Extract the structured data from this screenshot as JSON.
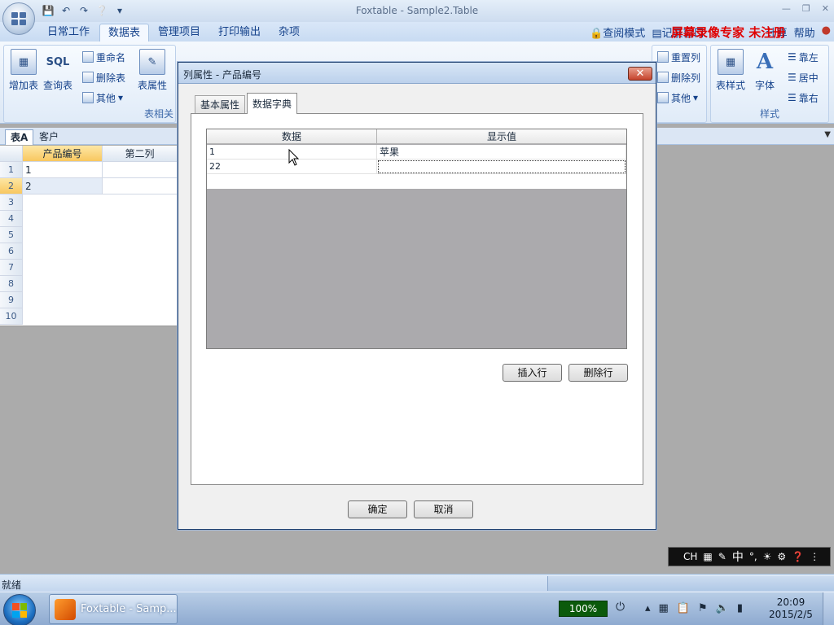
{
  "window": {
    "title": "Foxtable - Sample2.Table"
  },
  "ribbon_tabs": [
    "日常工作",
    "数据表",
    "管理项目",
    "打印输出",
    "杂项"
  ],
  "right_tools": [
    "查阅模式",
    "记录窗口",
    "计算",
    "帮助"
  ],
  "watermark": "屏幕录像专家 未注册",
  "ribbon": {
    "group1": {
      "label": "表相关",
      "add_table": "增加表",
      "query_table": "查询表",
      "sql": "SQL",
      "rename": "重命名",
      "delete_table": "删除表",
      "other": "其他",
      "table_props": "表属性"
    },
    "group_col": {
      "reset_col": "重置列",
      "delete_col": "删除列",
      "other": "其他"
    },
    "group_style": {
      "label": "样式",
      "table_style": "表样式",
      "font": "字体",
      "left": "靠左",
      "center": "居中",
      "right": "靠右"
    }
  },
  "doc_tabs": [
    "表A",
    "客户"
  ],
  "grid": {
    "columns": [
      "产品编号",
      "第二列"
    ],
    "row_numbers": [
      "1",
      "2",
      "3",
      "4",
      "5",
      "6",
      "7",
      "8",
      "9",
      "10"
    ],
    "cells": [
      "1",
      "2"
    ]
  },
  "dialog": {
    "title": "列属性 - 产品编号",
    "tabs": [
      "基本属性",
      "数据字典"
    ],
    "dict_headers": [
      "数据",
      "显示值"
    ],
    "dict_rows": [
      {
        "data": "1",
        "display": "苹果"
      },
      {
        "data": "22",
        "display": ""
      }
    ],
    "insert_row": "插入行",
    "delete_row": "删除行",
    "ok": "确定",
    "cancel": "取消"
  },
  "status": {
    "text": "就绪"
  },
  "ime": {
    "lang": "CH",
    "mode": "中"
  },
  "taskbar": {
    "app_label": "Foxtable - Samp...",
    "battery": "100%",
    "time": "20:09",
    "date": "2015/2/5"
  }
}
